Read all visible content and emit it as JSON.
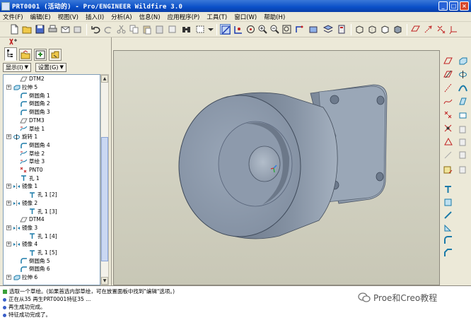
{
  "window": {
    "title": "PRT0001 (活动的) - Pro/ENGINEER Wildfire 3.0"
  },
  "menu": [
    "文件(F)",
    "编辑(E)",
    "视图(V)",
    "插入(I)",
    "分析(A)",
    "信息(N)",
    "应用程序(P)",
    "工具(T)",
    "窗口(W)",
    "帮助(H)"
  ],
  "tree_buttons": {
    "show": "显示(I)",
    "settings": "设置(G)"
  },
  "tree": [
    {
      "label": "DTM2",
      "icon": "datum-plane-icon",
      "expander": false,
      "indent": 1
    },
    {
      "label": "拉伸 5",
      "icon": "extrude-icon",
      "expander": true,
      "indent": 0
    },
    {
      "label": "倒圆角 1",
      "icon": "round-icon",
      "expander": false,
      "indent": 1
    },
    {
      "label": "倒圆角 2",
      "icon": "round-icon",
      "expander": false,
      "indent": 1
    },
    {
      "label": "倒圆角 3",
      "icon": "round-icon",
      "expander": false,
      "indent": 1
    },
    {
      "label": "DTM3",
      "icon": "datum-plane-icon",
      "expander": false,
      "indent": 1
    },
    {
      "label": "草绘 1",
      "icon": "sketch-icon",
      "expander": false,
      "indent": 1
    },
    {
      "label": "旋转 1",
      "icon": "revolve-icon",
      "expander": true,
      "indent": 0
    },
    {
      "label": "倒圆角 4",
      "icon": "round-icon",
      "expander": false,
      "indent": 1
    },
    {
      "label": "草绘 2",
      "icon": "sketch-icon",
      "expander": false,
      "indent": 1
    },
    {
      "label": "草绘 3",
      "icon": "sketch-icon",
      "expander": false,
      "indent": 1
    },
    {
      "label": "PNT0",
      "icon": "datum-point-icon",
      "expander": false,
      "indent": 1
    },
    {
      "label": "孔 1",
      "icon": "hole-icon",
      "expander": false,
      "indent": 1
    },
    {
      "label": "镜像 1",
      "icon": "mirror-icon",
      "expander": true,
      "indent": 0
    },
    {
      "label": "孔 1 [2]",
      "icon": "hole-icon",
      "expander": false,
      "indent": 2
    },
    {
      "label": "镜像 2",
      "icon": "mirror-icon",
      "expander": true,
      "indent": 0
    },
    {
      "label": "孔 1 [3]",
      "icon": "hole-icon",
      "expander": false,
      "indent": 2
    },
    {
      "label": "DTM4",
      "icon": "datum-plane-icon",
      "expander": false,
      "indent": 1
    },
    {
      "label": "镜像 3",
      "icon": "mirror-icon",
      "expander": true,
      "indent": 0
    },
    {
      "label": "孔 1 [4]",
      "icon": "hole-icon",
      "expander": false,
      "indent": 2
    },
    {
      "label": "镜像 4",
      "icon": "mirror-icon",
      "expander": true,
      "indent": 0
    },
    {
      "label": "孔 1 [5]",
      "icon": "hole-icon",
      "expander": false,
      "indent": 2
    },
    {
      "label": "倒圆角 5",
      "icon": "round-icon",
      "expander": false,
      "indent": 1
    },
    {
      "label": "倒圆角 6",
      "icon": "round-icon",
      "expander": false,
      "indent": 1
    },
    {
      "label": "拉伸 6",
      "icon": "extrude-icon",
      "expander": true,
      "indent": 0
    }
  ],
  "messages": [
    {
      "text": "选取一个草绘。(如果首选内部草绘，可在放置面板中找到\"编辑\"选项。)",
      "bullet": "green"
    },
    {
      "text": "正在从35 再生PRT0001特征35 ...",
      "bullet": "blue"
    },
    {
      "text": "再生成功完成。",
      "bullet": "blue"
    },
    {
      "text": "特征成功完成了。",
      "bullet": "blue"
    }
  ],
  "watermark": {
    "label": "Proe和Creo教程"
  },
  "colors": {
    "titlebar": "#0a4fc8",
    "chrome": "#ece9d8",
    "model": "#8f9cad",
    "viewport": "#d4d3c4"
  }
}
